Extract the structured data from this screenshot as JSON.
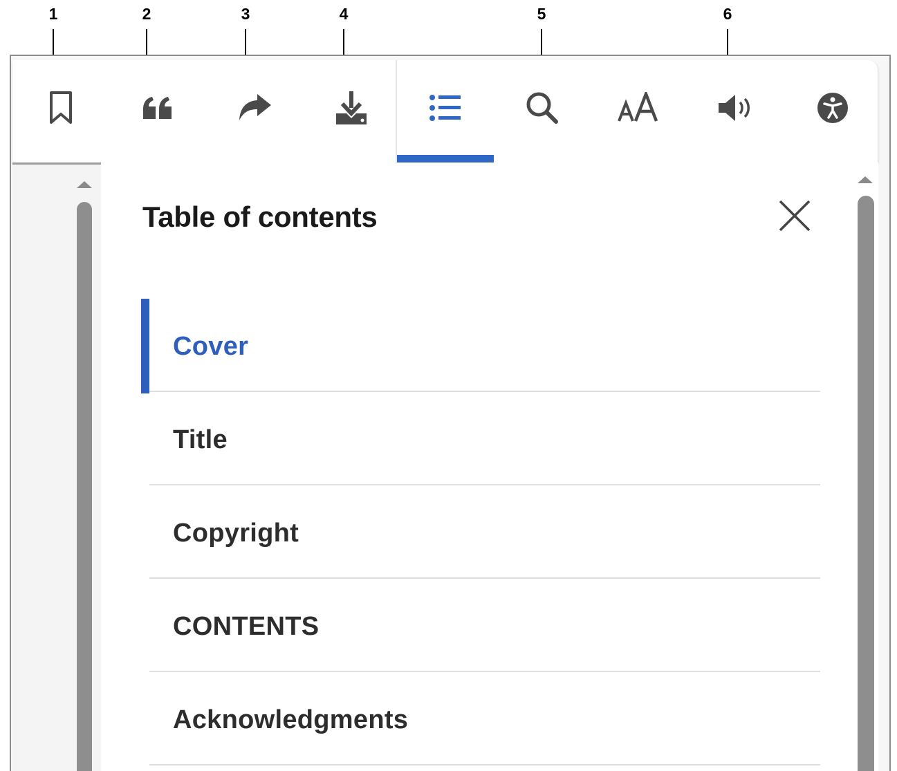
{
  "callouts": [
    "1",
    "2",
    "3",
    "4",
    "5",
    "6"
  ],
  "toolbar": {
    "left_tools": [
      {
        "icon": "bookmark-icon"
      },
      {
        "icon": "quote-icon"
      },
      {
        "icon": "share-arrow-icon"
      },
      {
        "icon": "download-icon"
      }
    ],
    "right_tools": [
      {
        "icon": "table-of-contents-icon",
        "active": true
      },
      {
        "icon": "search-icon"
      },
      {
        "icon": "text-size-icon"
      },
      {
        "icon": "speaker-icon"
      },
      {
        "icon": "accessibility-icon"
      }
    ],
    "active_color": "#2f67c6",
    "icon_color": "#4a4a4a"
  },
  "toc": {
    "title": "Table of contents",
    "close_icon": "close-icon",
    "items": [
      {
        "label": "Cover",
        "active": true
      },
      {
        "label": "Title"
      },
      {
        "label": "Copyright"
      },
      {
        "label": "CONTENTS"
      },
      {
        "label": "Acknowledgments"
      }
    ],
    "accent_color": "#2f5fbd"
  }
}
